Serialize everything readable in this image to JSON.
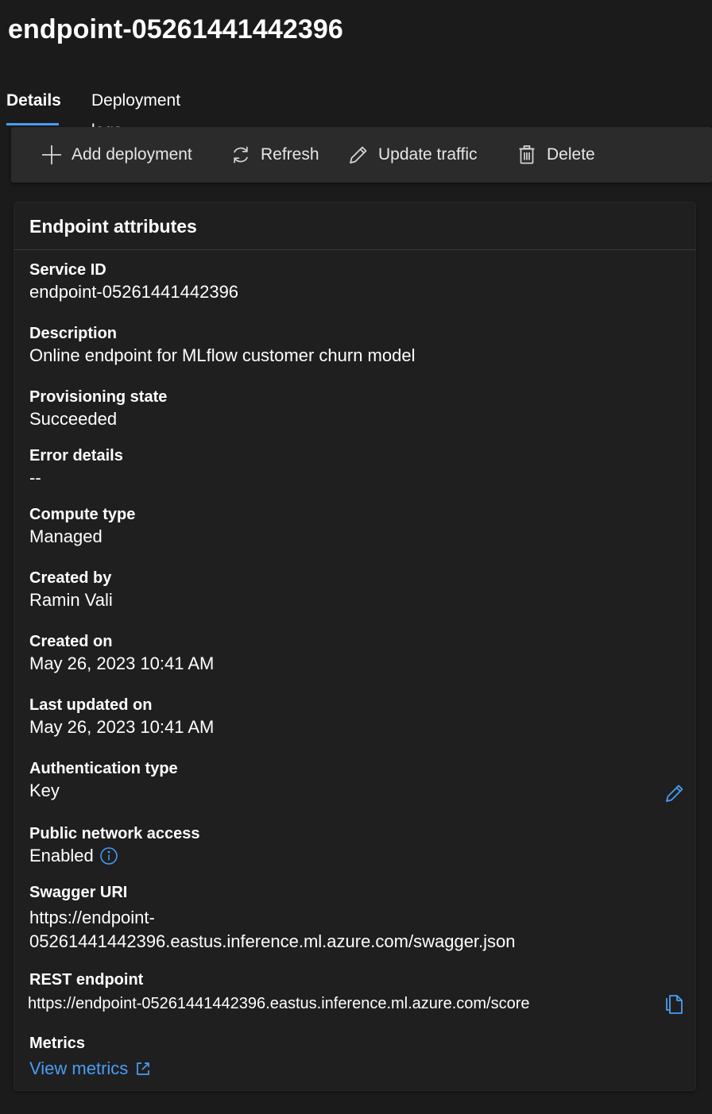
{
  "page": {
    "title": "endpoint-05261441442396"
  },
  "tabs": [
    {
      "label": "Details",
      "active": true
    },
    {
      "label": "Deployment logs",
      "active": false
    }
  ],
  "toolbar": {
    "add_label": "Add deployment",
    "refresh_label": "Refresh",
    "update_label": "Update traffic",
    "delete_label": "Delete"
  },
  "attributes": {
    "header": "Endpoint attributes",
    "service_id": {
      "label": "Service ID",
      "value": "endpoint-05261441442396"
    },
    "description": {
      "label": "Description",
      "value": "Online endpoint for MLflow customer churn model"
    },
    "provisioning_state": {
      "label": "Provisioning state",
      "value": "Succeeded"
    },
    "error_details": {
      "label": "Error details",
      "value": "--"
    },
    "compute_type": {
      "label": "Compute type",
      "value": "Managed"
    },
    "created_by": {
      "label": "Created by",
      "value": "Ramin Vali"
    },
    "created_on": {
      "label": "Created on",
      "value": "May 26, 2023 10:41 AM"
    },
    "last_updated_on": {
      "label": "Last updated on",
      "value": "May 26, 2023 10:41 AM"
    },
    "auth_type": {
      "label": "Authentication type",
      "value": "Key"
    },
    "public_network_access": {
      "label": "Public network access",
      "value": "Enabled"
    },
    "swagger_uri": {
      "label": "Swagger URI",
      "value_line1": "https://endpoint-",
      "value_line2": "05261441442396.eastus.inference.ml.azure.com/swagger.json"
    },
    "rest_endpoint": {
      "label": "REST endpoint",
      "value": "https://endpoint-05261441442396.eastus.inference.ml.azure.com/score"
    },
    "metrics": {
      "label": "Metrics",
      "link": "View metrics"
    }
  },
  "icons": {
    "add": "add-icon",
    "refresh": "refresh-icon",
    "update": "pencil-icon",
    "delete": "trash-icon",
    "edit_auth": "edit-icon",
    "info": "info-icon",
    "copy": "copy-icon",
    "external": "external-link-icon"
  },
  "colors": {
    "background": "#1b1b1b",
    "card": "#1f1f1f",
    "toolbar": "#2b2b2b",
    "accent": "#479ef5",
    "text": "#ffffff"
  }
}
